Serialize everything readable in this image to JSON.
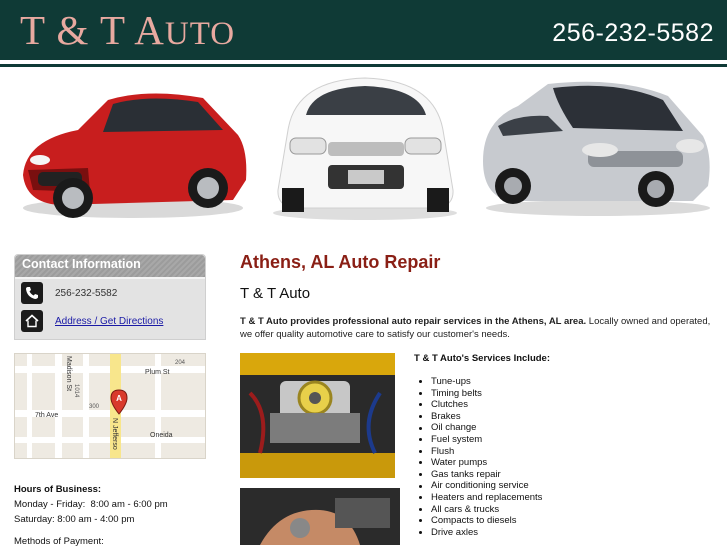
{
  "header": {
    "logo_main": "T & T A",
    "logo_small": "UTO",
    "phone": "256-232-5582",
    "colors": {
      "bg": "#0f3a36",
      "logo": "#e8a9a0"
    }
  },
  "sidebar": {
    "contact_title": "Contact Information",
    "phone": "256-232-5582",
    "directions_link": "Address / Get Directions",
    "map": {
      "streets": [
        "Plum St",
        "7th Ave",
        "Oneida",
        "Madison St",
        "N Jefferso"
      ],
      "numbers": [
        "204",
        "1014",
        "300"
      ],
      "pin_label": "A"
    },
    "hours_title": "Hours of Business:",
    "hours_weekday": "Monday - Friday:  8:00 am - 6:00 pm",
    "hours_saturday": "Saturday: 8:00 am - 4:00 pm",
    "payment_title": "Methods of Payment:"
  },
  "main": {
    "title": "Athens, AL Auto Repair",
    "subtitle": "T & T Auto",
    "intro_bold": "T & T Auto provides professional auto repair services in the Athens, AL area.",
    "intro_rest": " Locally owned and operated, we offer quality automotive care to satisfy our customer's needs.",
    "services_title": "T & T Auto's Services Include:",
    "services": [
      "Tune-ups",
      "Timing belts",
      "Clutches",
      "Brakes",
      "Oil change",
      "Fuel system",
      "Flush",
      "Water pumps",
      "Gas tanks repair",
      "Air conditioning service",
      "Heaters and replacements",
      "All cars & trucks",
      "Compacts to diesels",
      "Drive axles"
    ]
  },
  "icons": [
    "phone-icon",
    "home-icon",
    "map-pin-icon"
  ]
}
